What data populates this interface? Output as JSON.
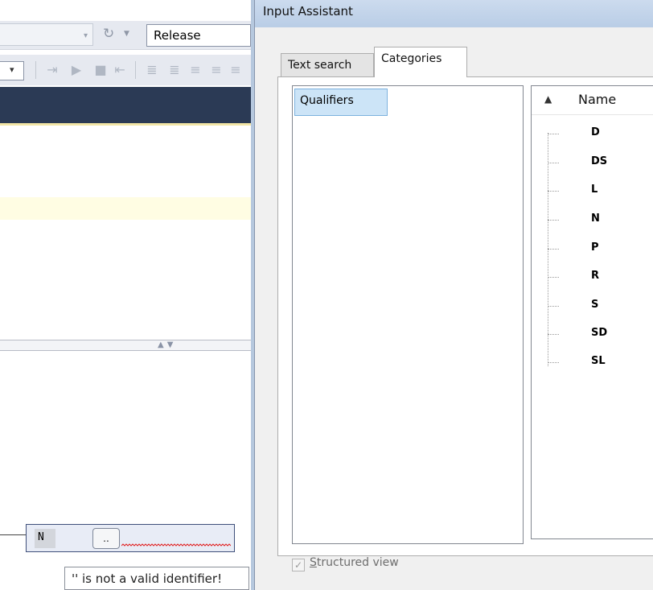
{
  "ide": {
    "configuration": "Release",
    "edit_value": "N",
    "ellipsis_label": "..",
    "error_message": "'' is not a valid identifier!"
  },
  "dialog": {
    "title": "Input Assistant",
    "tabs": [
      {
        "label": "Text search",
        "selected": false
      },
      {
        "label": "Categories",
        "selected": true
      }
    ],
    "categories": [
      {
        "label": "Qualifiers",
        "selected": true
      }
    ],
    "names_header": "Name",
    "names": [
      "D",
      "DS",
      "L",
      "N",
      "P",
      "R",
      "S",
      "SD",
      "SL"
    ],
    "structured_view": {
      "accel": "S",
      "rest": "tructured view",
      "checked": true,
      "enabled": false
    }
  },
  "colors": {
    "title_bar": "#c3d5ec",
    "selection": "#cce4f7",
    "ide_dark_bar": "#2b3a55",
    "error_squiggle": "#e02020"
  },
  "icons": [
    "refresh-icon",
    "chevron-down-icon",
    "step-into-icon",
    "play-icon",
    "stop-icon",
    "step-out-icon",
    "sort-ascending-icon",
    "checkbox-checked-icon"
  ]
}
